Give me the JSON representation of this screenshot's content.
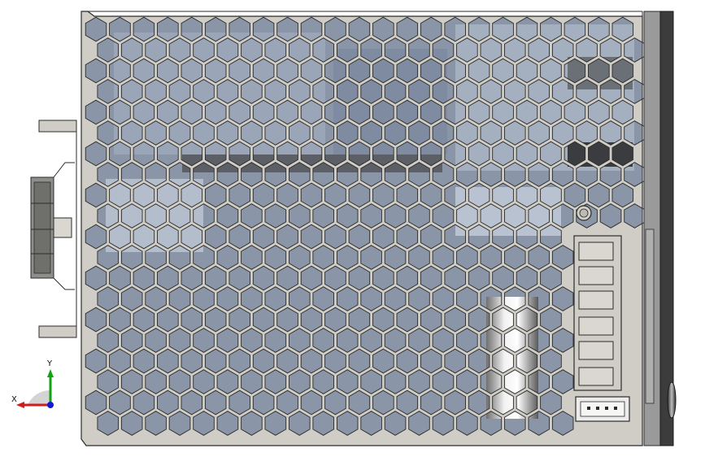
{
  "viewport": {
    "background": "#ffffff",
    "model": "power-supply-enclosure",
    "view": "front"
  },
  "colors": {
    "panel": "#cfcdc6",
    "panel_edge": "#2b2b2b",
    "interior": "#8a96a8",
    "interior_light": "#b9c2d0",
    "side_rail_dark": "#3c3c3c",
    "side_rail_mid": "#9a9a9a",
    "connector_body": "#c9c7c0",
    "x_axis": "#d11a1a",
    "y_axis": "#12a312",
    "z_axis": "#1616d6"
  },
  "triad": {
    "x_label": "X",
    "y_label": "Y"
  }
}
